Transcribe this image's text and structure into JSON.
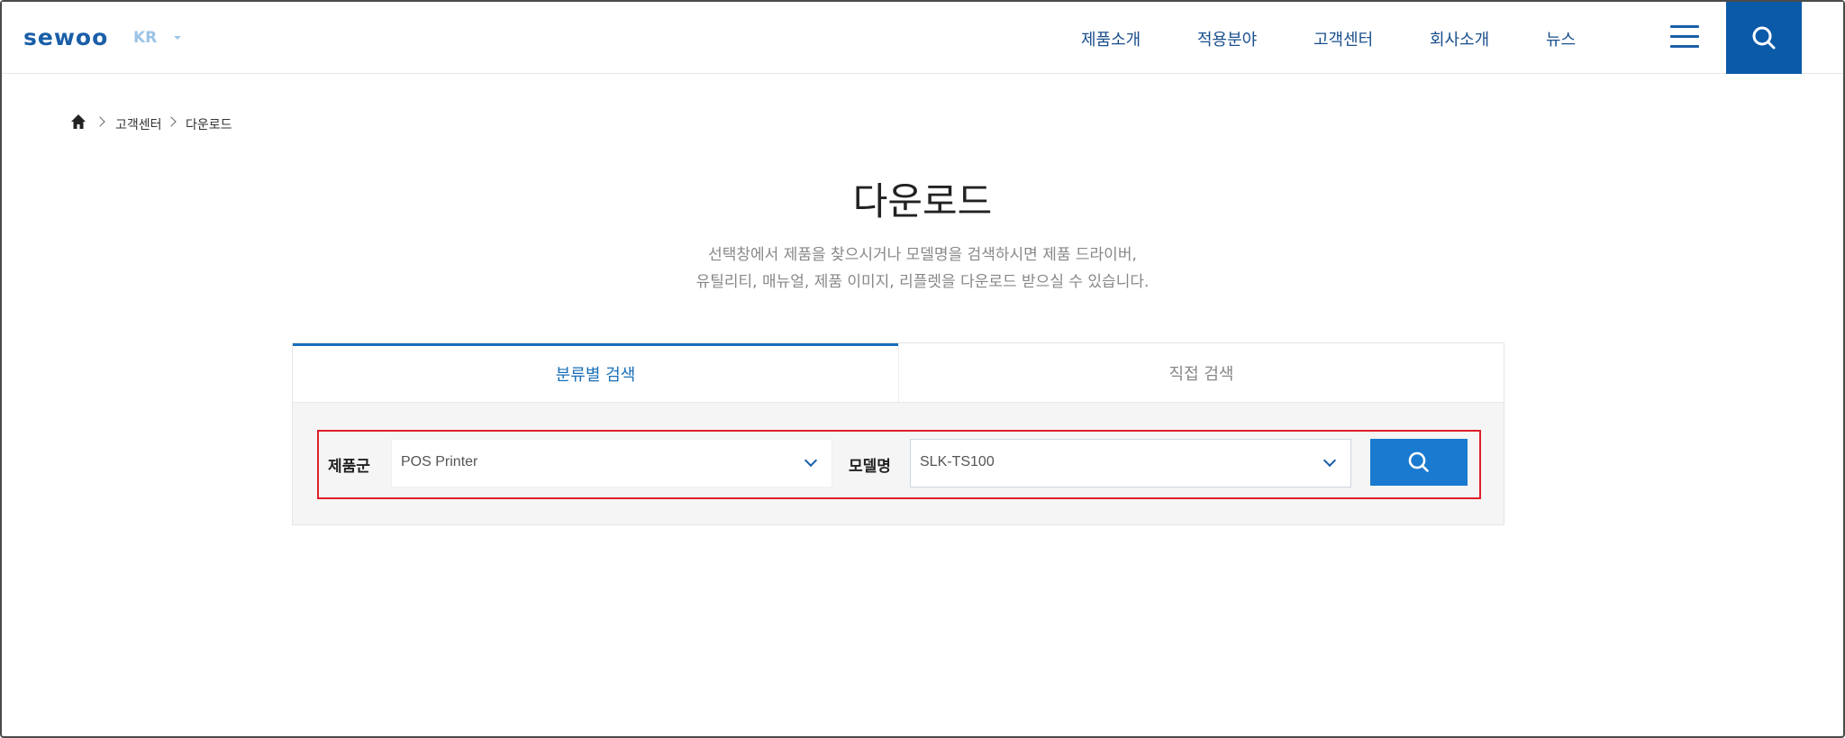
{
  "header": {
    "logo": "sewoo",
    "lang": "KR",
    "nav": [
      "제품소개",
      "적용분야",
      "고객센터",
      "회사소개",
      "뉴스"
    ]
  },
  "breadcrumb": {
    "items": [
      "고객센터",
      "다운로드"
    ]
  },
  "page": {
    "title": "다운로드",
    "desc_line1": "선택창에서 제품을 찾으시거나 모델명을 검색하시면 제품 드라이버,",
    "desc_line2": "유틸리티, 매뉴얼, 제품 이미지, 리플렛을 다운로드 받으실 수 있습니다."
  },
  "tabs": {
    "category_search": "분류별 검색",
    "direct_search": "직접 검색"
  },
  "search": {
    "product_group_label": "제품군",
    "product_group_value": "POS Printer",
    "model_label": "모델명",
    "model_value": "SLK-TS100"
  },
  "colors": {
    "brand": "#0b5aa8",
    "accent": "#1a7ad0",
    "highlight_border": "#e01e2b"
  }
}
